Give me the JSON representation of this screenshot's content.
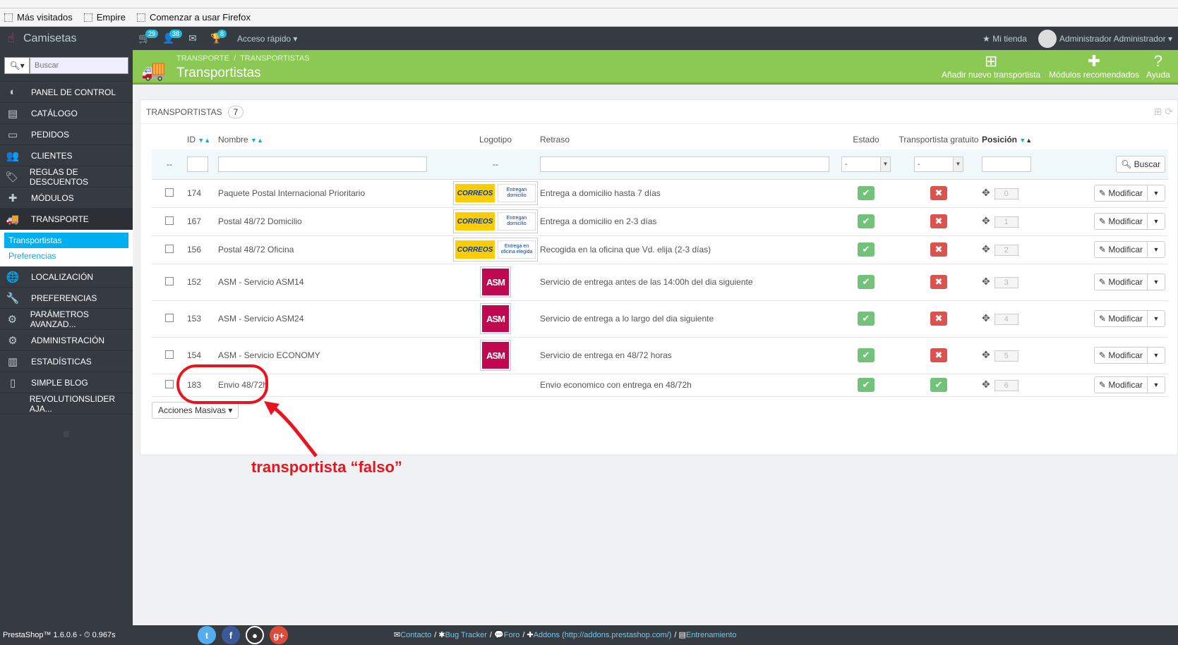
{
  "browser": {
    "bookmarks": [
      "Más visitados",
      "Empire",
      "Comenzar a usar Firefox"
    ]
  },
  "topbar": {
    "shop_name": "Camisetas",
    "badges": {
      "orders": "29",
      "customers": "38",
      "trophy": "8"
    },
    "quick_access": "Acceso rápido",
    "my_store": "Mi tienda",
    "user": "Administrador Administrador"
  },
  "sidebar": {
    "search_placeholder": "Buscar",
    "items": [
      {
        "label": "PANEL DE CONTROL",
        "icon": "dashboard-icon"
      },
      {
        "label": "CATÁLOGO",
        "icon": "book-icon"
      },
      {
        "label": "PEDIDOS",
        "icon": "credit-card-icon"
      },
      {
        "label": "CLIENTES",
        "icon": "users-icon"
      },
      {
        "label": "REGLAS DE DESCUENTOS",
        "icon": "tags-icon"
      },
      {
        "label": "MÓDULOS",
        "icon": "puzzle-icon"
      },
      {
        "label": "TRANSPORTE",
        "icon": "truck-icon"
      },
      {
        "label": "LOCALIZACIÓN",
        "icon": "globe-icon"
      },
      {
        "label": "PREFERENCIAS",
        "icon": "wrench-icon"
      },
      {
        "label": "PARÁMETROS AVANZAD...",
        "icon": "cogs-icon"
      },
      {
        "label": "ADMINISTRACIÓN",
        "icon": "cog-icon"
      },
      {
        "label": "ESTADÍSTICAS",
        "icon": "bar-chart-icon"
      },
      {
        "label": "SIMPLE BLOG",
        "icon": "file-icon"
      },
      {
        "label": "REVOLUTIONSLIDER AJA...",
        "icon": "none"
      }
    ],
    "submenu": [
      "Transportistas",
      "Preferencias"
    ]
  },
  "toolbar": {
    "breadcrumb": [
      "TRANSPORTE",
      "TRANSPORTISTAS"
    ],
    "title": "Transportistas",
    "buttons": [
      "Añadir nuevo transportista",
      "Módulos recomendados",
      "Ayuda"
    ]
  },
  "panel": {
    "title": "TRANSPORTISTAS",
    "count": "7",
    "columns": [
      "ID",
      "Nombre",
      "Logotipo",
      "Retraso",
      "Estado",
      "Transportista gratuito",
      "Posición"
    ],
    "filter": {
      "dash": "--",
      "logo_dash": "--",
      "select_value": "-",
      "search_label": "Buscar"
    },
    "rows": [
      {
        "id": "174",
        "name": "Paquete Postal Internacional Prioritario",
        "logo": "correos",
        "logo_sub": "Entregan domicilio",
        "delay": "Entrega a domicilio hasta 7 días",
        "free": false,
        "position": "0"
      },
      {
        "id": "167",
        "name": "Postal 48/72 Domicilio",
        "logo": "correos",
        "logo_sub": "Entregan domicilio",
        "delay": "Entrega a domicilio en 2-3 días",
        "free": false,
        "position": "1"
      },
      {
        "id": "156",
        "name": "Postal 48/72 Oficina",
        "logo": "correos",
        "logo_sub": "Entrega en oficina elegida",
        "delay": "Recogida en la oficina que Vd. elija (2-3 días)",
        "free": false,
        "position": "2"
      },
      {
        "id": "152",
        "name": "ASM - Servicio ASM14",
        "logo": "asm",
        "logo_sub": "",
        "delay": "Servicio de entrega antes de las 14:00h del dia siguiente",
        "free": false,
        "position": "3"
      },
      {
        "id": "153",
        "name": "ASM - Servicio ASM24",
        "logo": "asm",
        "logo_sub": "",
        "delay": "Servicio de entrega a lo largo del dia siguiente",
        "free": false,
        "position": "4"
      },
      {
        "id": "154",
        "name": "ASM - Servicio ECONOMY",
        "logo": "asm",
        "logo_sub": "",
        "delay": "Servicio de entrega en 48/72 horas",
        "free": false,
        "position": "5"
      },
      {
        "id": "183",
        "name": "Envio 48/72h",
        "logo": "",
        "logo_sub": "",
        "delay": "Envio economico con entrega en 48/72h",
        "free": true,
        "position": "6"
      }
    ],
    "modify_label": "Modificar",
    "bulk_label": "Acciones Masivas"
  },
  "logos": {
    "correos_text": "CORREOS",
    "asm_text": "ASM"
  },
  "annotation": {
    "text": "transportista “falso”",
    "color": "#e8141e"
  },
  "footer": {
    "version": "PrestaShop™ 1.6.0.6 - ⏱ 0.967s",
    "links": [
      "Contacto",
      "Bug Tracker",
      "Foro",
      "Addons (http://addons.prestashop.com/)",
      "Entrenamiento"
    ]
  },
  "colors": {
    "accent": "#8bc954",
    "link": "#00aff0",
    "sidebar": "#363a41"
  }
}
